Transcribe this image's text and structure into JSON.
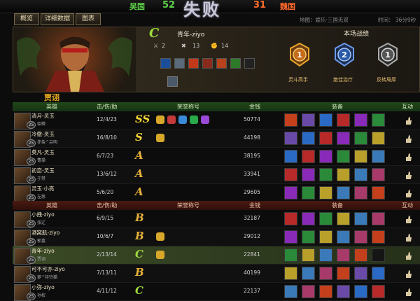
{
  "header": {
    "wu_name": "吴国",
    "wu_score": "52",
    "wei_name": "魏国",
    "wei_score": "31",
    "result": "失败"
  },
  "tabs": [
    {
      "label": "概览"
    },
    {
      "label": "详细数据"
    },
    {
      "label": "图表"
    }
  ],
  "match_info": {
    "map": "地图：娱乐·三国无双",
    "time": "时间：  36分9秒"
  },
  "hero_panel": {
    "player_name": "青年-ziyo",
    "grade": "C",
    "kills": "2",
    "deaths": "13",
    "assists": "14",
    "record_title": "本场战绩",
    "medals": [
      {
        "label": "灵斗高手",
        "icon": "medal-rank-1-icon"
      },
      {
        "label": "绝佳治疗",
        "icon": "medal-rank-2-icon"
      },
      {
        "label": "反转局厚",
        "icon": "medal-rank-3-icon"
      }
    ]
  },
  "player_tag": "贾诩",
  "columns": {
    "hero": "英雄",
    "kda": "击/伤/助",
    "honor": "荣誉称号",
    "gold": "金钱",
    "gear": "装备",
    "interact": "互动"
  },
  "team_wu": [
    {
      "name": "清月-灵玉",
      "sub": "貂蝉",
      "level": "25",
      "kda": "12/4/23",
      "gold": "50774",
      "grade": "SS"
    },
    {
      "name": "冷傲-灵玉",
      "sub": "赤兔^吕明",
      "level": "25",
      "kda": "16/8/10",
      "gold": "44198",
      "grade": "S"
    },
    {
      "name": "莫凡-灵玉",
      "sub": "曹操",
      "level": "25",
      "kda": "6/7/23",
      "gold": "38195",
      "grade": "A"
    },
    {
      "name": "初恋-灵玉",
      "sub": "于禁",
      "level": "25",
      "kda": "13/6/12",
      "gold": "33941",
      "grade": "A"
    },
    {
      "name": "灵玉·小亮",
      "sub": "左慈",
      "level": "25",
      "kda": "5/6/20",
      "gold": "29605",
      "grade": "A"
    }
  ],
  "team_wei": [
    {
      "name": "小拽-ziyo",
      "sub": "张辽",
      "level": "25",
      "kda": "6/9/15",
      "gold": "32187",
      "grade": "B"
    },
    {
      "name": "酒窝肌-ziyo",
      "sub": "郭嘉",
      "level": "25",
      "kda": "10/6/7",
      "gold": "29012",
      "grade": "B"
    },
    {
      "name": "青年-ziyo",
      "sub": "贾诩",
      "level": "25",
      "kda": "2/13/14",
      "gold": "22841",
      "grade": "C"
    },
    {
      "name": "可不可亦-ziyo",
      "sub": "萝^持铃猫",
      "level": "25",
      "kda": "7/13/11",
      "gold": "40199",
      "grade": "B"
    },
    {
      "name": "小弥-ziyo",
      "sub": "孙权",
      "level": "25",
      "kda": "4/11/12",
      "gold": "22137",
      "grade": "C"
    }
  ],
  "colors": {
    "wu": "#5fd04a",
    "wei": "#ff6a2a",
    "accent": "#e8a820",
    "self_row": "#3b4a26"
  }
}
